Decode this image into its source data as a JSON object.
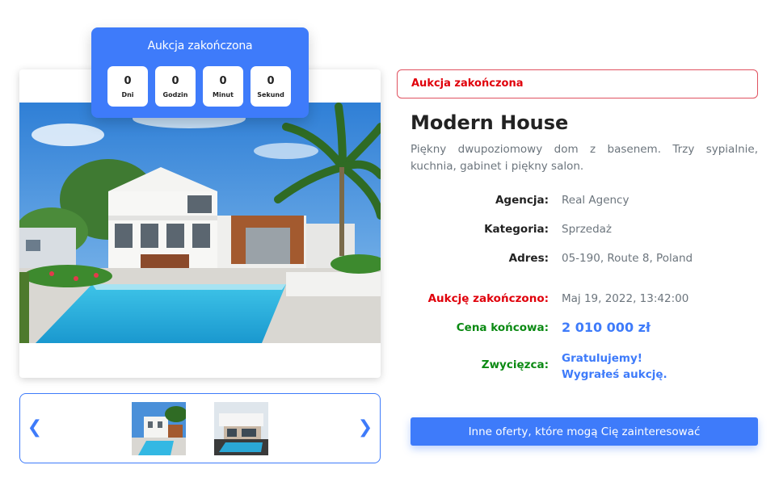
{
  "countdown": {
    "title": "Aukcja zakończona",
    "cells": [
      {
        "value": "0",
        "unit": "Dni"
      },
      {
        "value": "0",
        "unit": "Godzin"
      },
      {
        "value": "0",
        "unit": "Minut"
      },
      {
        "value": "0",
        "unit": "Sekund"
      }
    ]
  },
  "gallery": {
    "prev_icon": "chevron-left-icon",
    "next_icon": "chevron-right-icon"
  },
  "status": {
    "text": "Aukcja zakończona"
  },
  "property": {
    "title": "Modern House",
    "description": "Piękny dwupoziomowy dom z basenem. Trzy sypialnie, kuchnia, gabinet i piękny salon.",
    "agency_label": "Agencja:",
    "agency": "Real Agency",
    "category_label": "Kategoria:",
    "category": "Sprzedaż",
    "address_label": "Adres:",
    "address": "05-190, Route 8, Poland",
    "ended_label": "Aukcję zakończono:",
    "ended": "Maj 19, 2022, 13:42:00",
    "final_price_label": "Cena końcowa:",
    "final_price": "2 010 000 zł",
    "winner_label": "Zwycięzca:",
    "winner_line1": "Gratulujemy!",
    "winner_line2": "Wygrałeś aukcję."
  },
  "offers_button": {
    "label": "Inne oferty, które mogą Cię zainteresować"
  },
  "colors": {
    "accent": "#3e7bfa",
    "red": "#e0000b",
    "green": "#0b8a13"
  }
}
